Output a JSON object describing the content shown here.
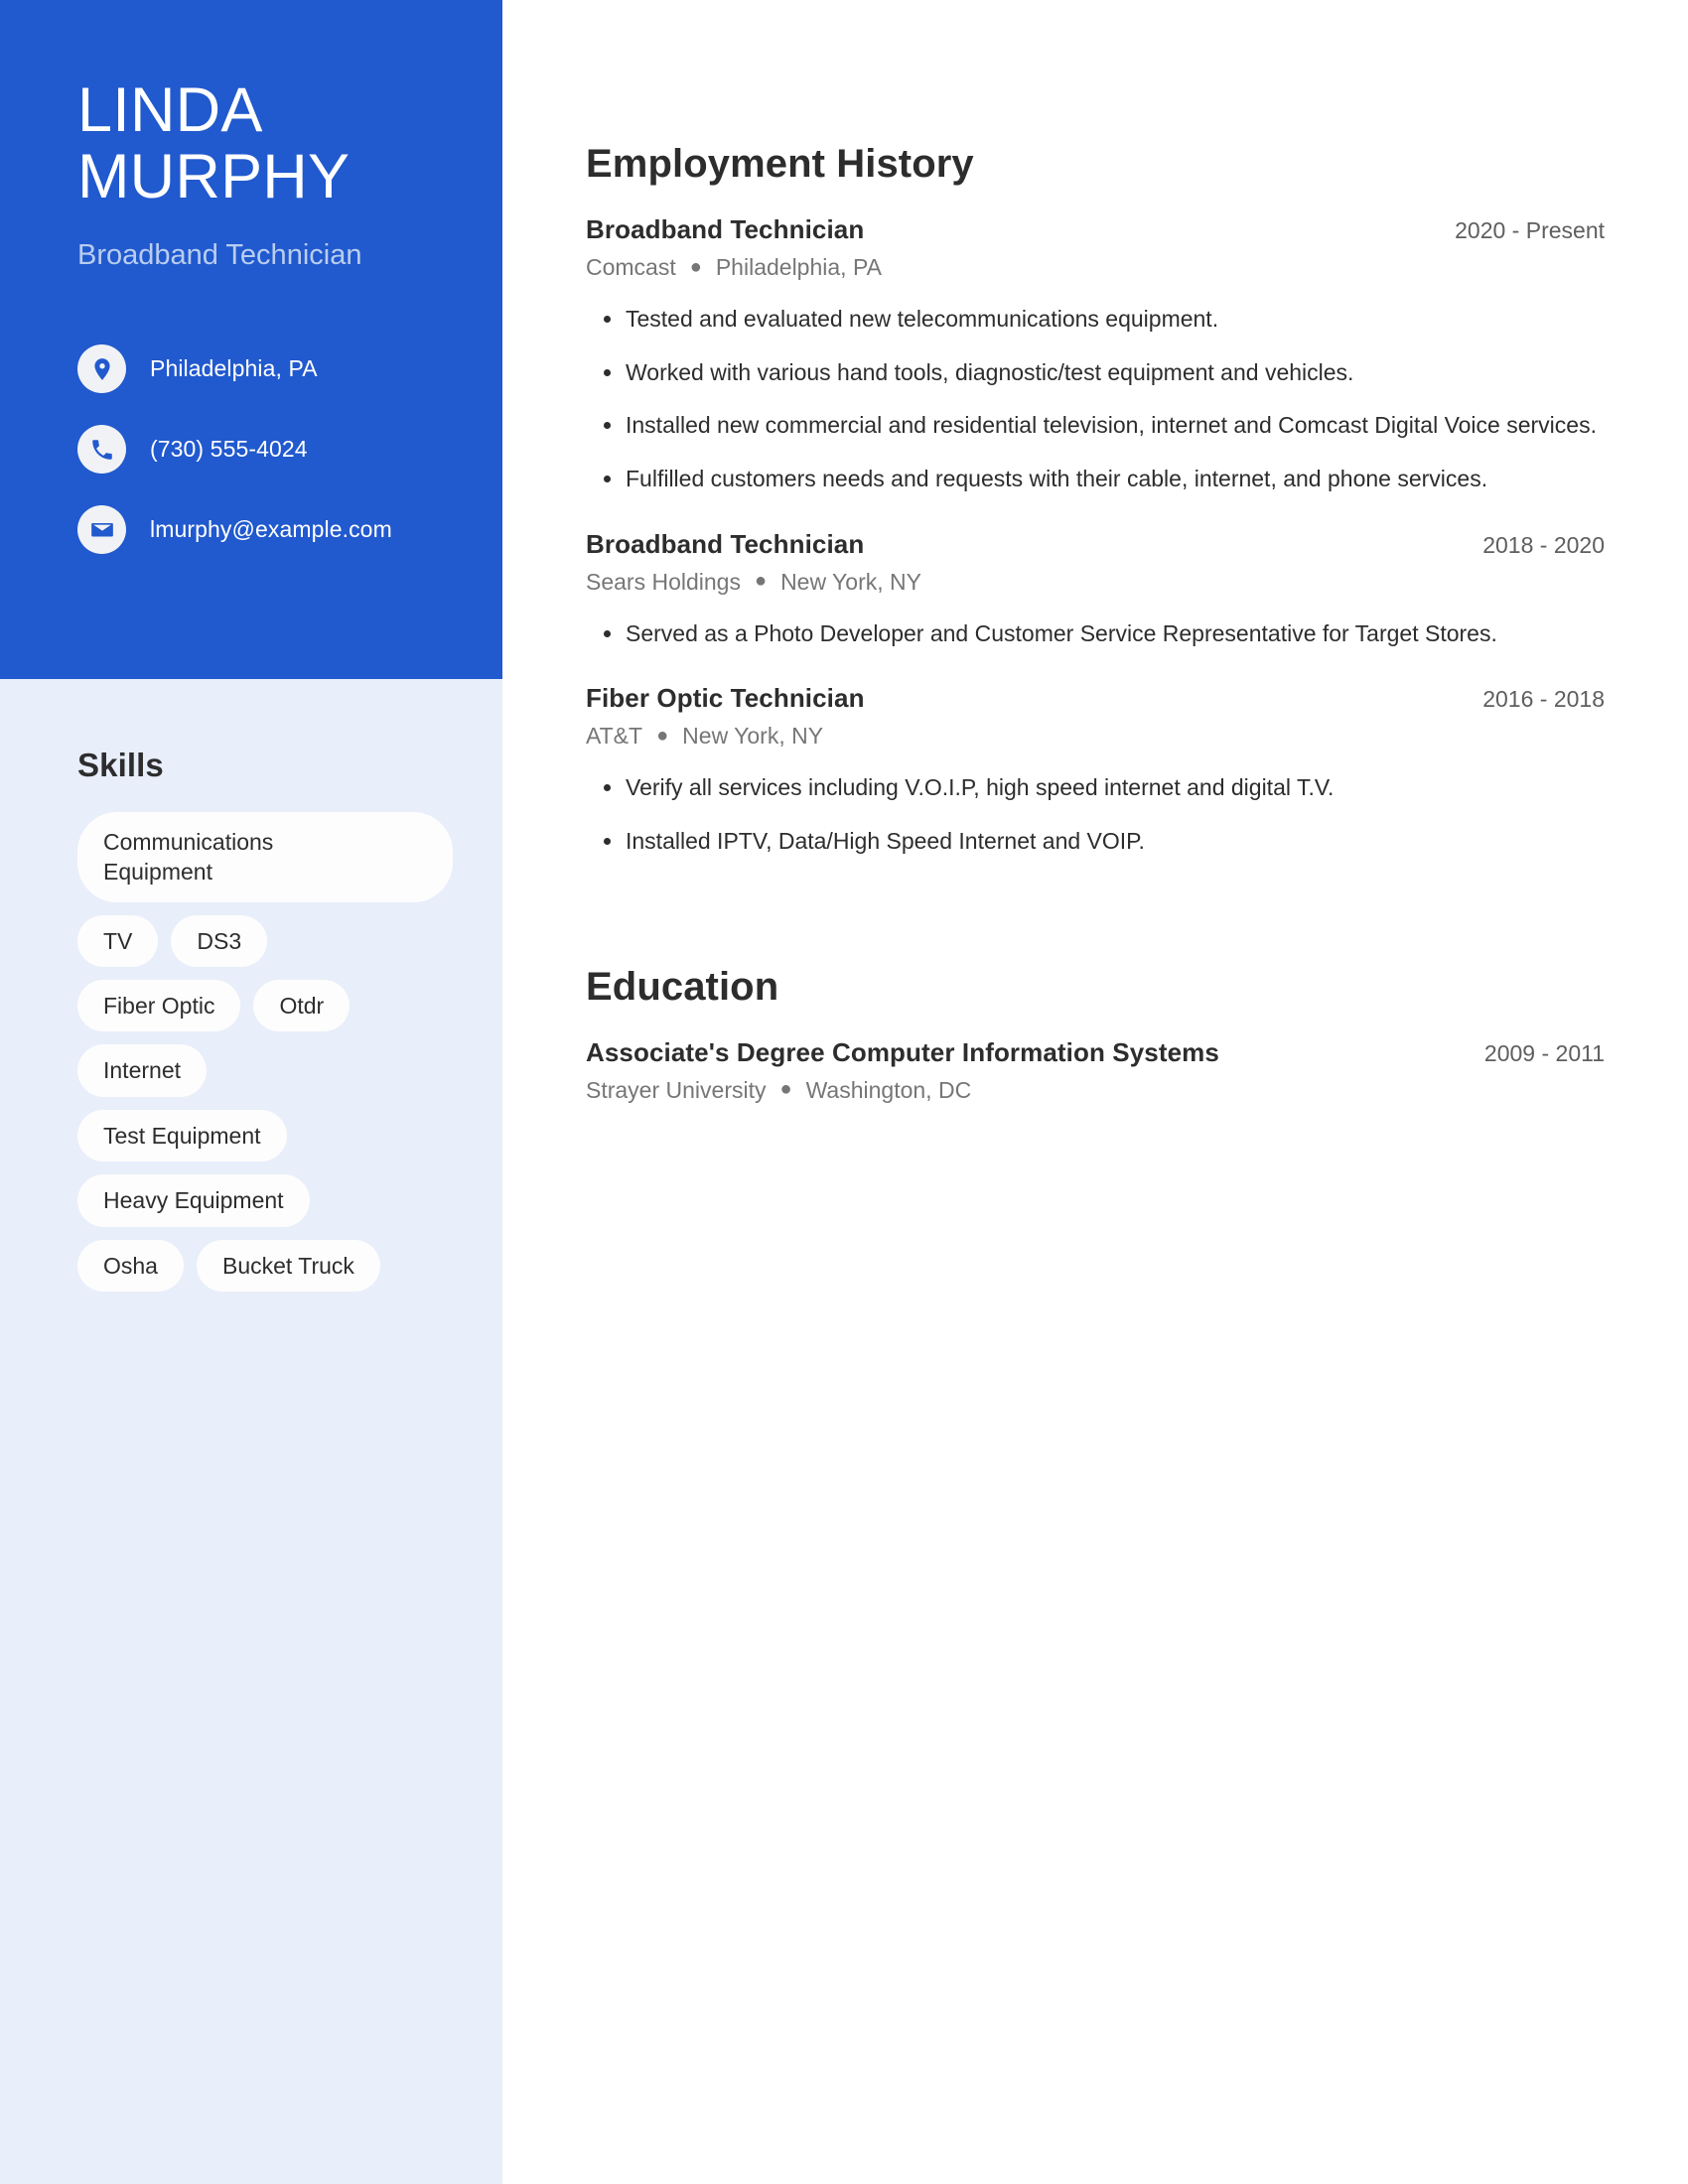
{
  "sidebar": {
    "name_first": "LINDA",
    "name_last": "MURPHY",
    "job_title": "Broadband Technician",
    "contact": [
      {
        "icon": "location-pin-icon",
        "text": "Philadelphia, PA"
      },
      {
        "icon": "phone-icon",
        "text": "(730) 555-4024"
      },
      {
        "icon": "envelope-icon",
        "text": "lmurphy@example.com"
      }
    ],
    "skills_heading": "Skills",
    "skill_rows": [
      [
        "Communications\nEquipment"
      ],
      [
        "TV",
        "DS3"
      ],
      [
        "Fiber Optic",
        "Otdr"
      ],
      [
        "Internet"
      ],
      [
        "Test Equipment"
      ],
      [
        "Heavy Equipment"
      ],
      [
        "Osha",
        "Bucket Truck"
      ]
    ]
  },
  "main": {
    "employment_heading": "Employment History",
    "jobs": [
      {
        "title": "Broadband Technician",
        "date": "2020 - Present",
        "company": "Comcast",
        "location": "Philadelphia, PA",
        "bullets": [
          "Tested and evaluated new telecommunications equipment.",
          "Worked with various hand tools, diagnostic/test equipment and vehicles.",
          "Installed new commercial and residential television, internet and Comcast Digital Voice services.",
          "Fulfilled customers needs and requests with their cable, internet, and phone services."
        ]
      },
      {
        "title": "Broadband Technician",
        "date": "2018 - 2020",
        "company": "Sears Holdings",
        "location": "New York, NY",
        "bullets": [
          "Served as a Photo Developer and Customer Service Representative for Target Stores."
        ]
      },
      {
        "title": "Fiber Optic Technician",
        "date": "2016 - 2018",
        "company": "AT&T",
        "location": "New York, NY",
        "bullets": [
          "Verify all services including V.O.I.P, high speed internet and digital T.V.",
          "Installed IPTV, Data/High Speed Internet and VOIP."
        ]
      }
    ],
    "education_heading": "Education",
    "education": [
      {
        "title": "Associate's Degree Computer Information Systems",
        "date": "2009 - 2011",
        "school": "Strayer University",
        "location": "Washington, DC"
      }
    ]
  },
  "colors": {
    "accent_blue": "#2159ce",
    "sidebar_bg": "#e8eefa",
    "pill_bg": "#fdfdfd",
    "subtitle": "#b9cdf0",
    "text_dark": "#2d2d2d",
    "text_muted": "#767676"
  }
}
